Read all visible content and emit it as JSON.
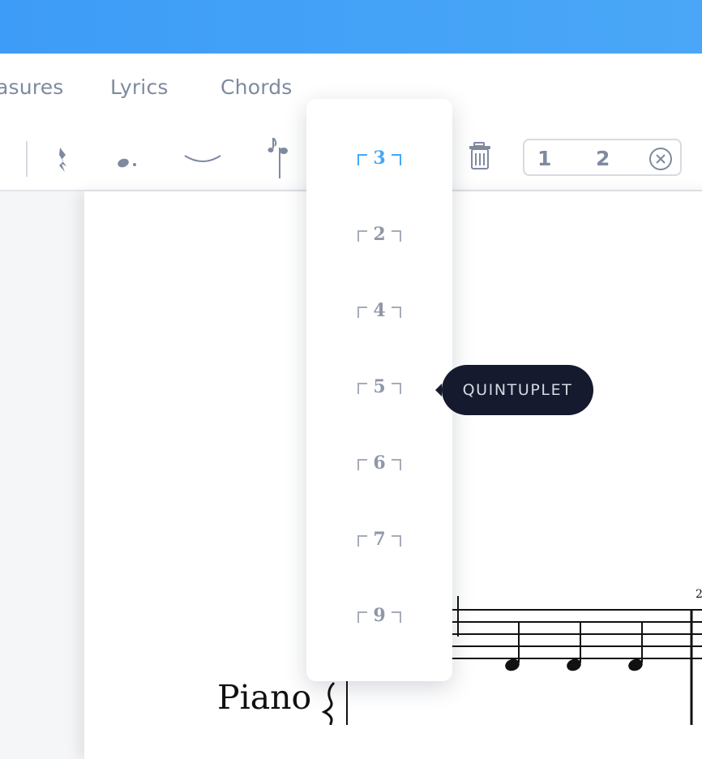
{
  "tabs": [
    "asures",
    "Lyrics",
    "Chords"
  ],
  "voices": [
    "1",
    "2"
  ],
  "tuplets": [
    "3",
    "2",
    "4",
    "5",
    "6",
    "7",
    "9"
  ],
  "selected_tuplet": "3",
  "tooltip": "QUINTUPLET",
  "instrument": "Piano",
  "colors": {
    "accent": "#45a7f7",
    "topbar": "#4aa7f7",
    "tooltip_bg": "#151a2e"
  }
}
